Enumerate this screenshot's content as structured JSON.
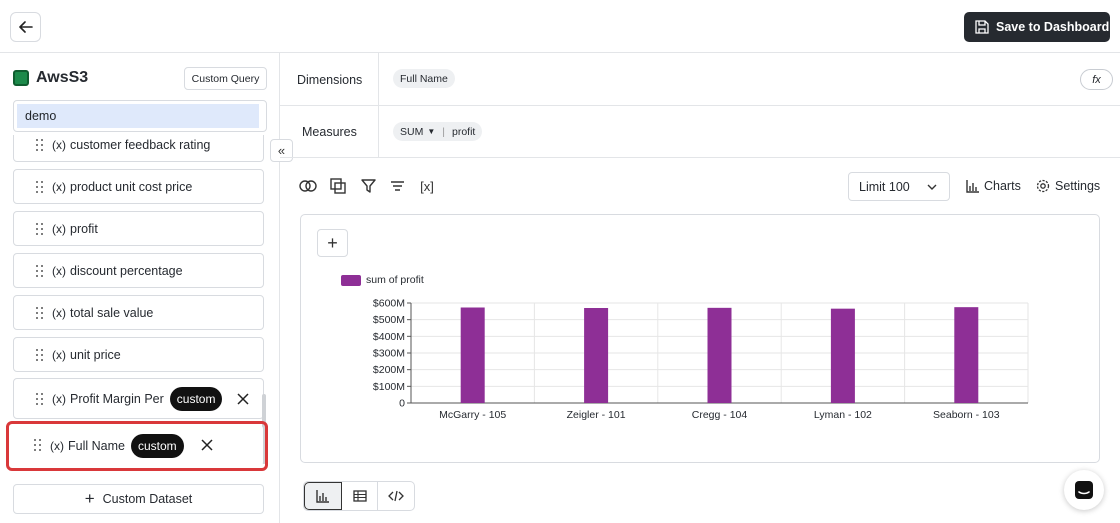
{
  "header": {
    "save_label": "Save to Dashboard"
  },
  "sidebar": {
    "datasource": "AwsS3",
    "custom_query_label": "Custom Query",
    "search_value": "demo",
    "fields": [
      {
        "fx": "(x)",
        "label": "customer feedback rating"
      },
      {
        "fx": "(x)",
        "label": "product unit cost price"
      },
      {
        "fx": "(x)",
        "label": "profit"
      },
      {
        "fx": "(x)",
        "label": "discount percentage"
      },
      {
        "fx": "(x)",
        "label": "total sale value"
      },
      {
        "fx": "(x)",
        "label": "unit price"
      },
      {
        "fx": "(x)",
        "label": "Profit Margin Per",
        "tag": "custom"
      },
      {
        "fx": "(x)",
        "label": "Full Name",
        "tag": "custom"
      }
    ],
    "custom_dataset_label": "Custom Dataset"
  },
  "query": {
    "dimensions_label": "Dimensions",
    "dimension_pill": "Full Name",
    "measures_label": "Measures",
    "measure_agg": "SUM",
    "measure_field": "profit",
    "fx_label": "fx"
  },
  "toolbar": {
    "limit_value": "Limit 100",
    "charts_label": "Charts",
    "settings_label": "Settings",
    "var_label": "[x]"
  },
  "chart_data": {
    "type": "bar",
    "categories": [
      "McGarry - 105",
      "Zeigler - 101",
      "Cregg - 104",
      "Lyman - 102",
      "Seaborn - 103"
    ],
    "series": [
      {
        "name": "sum of profit",
        "values": [
          573000000,
          570000000,
          571000000,
          566000000,
          575000000
        ]
      }
    ],
    "ytick_labels": [
      "$600M",
      "$500M",
      "$400M",
      "$300M",
      "$200M",
      "$100M",
      "0"
    ],
    "ylim": [
      0,
      600000000
    ],
    "color": "#8e2f96",
    "grid": true,
    "legend": "top-left"
  }
}
